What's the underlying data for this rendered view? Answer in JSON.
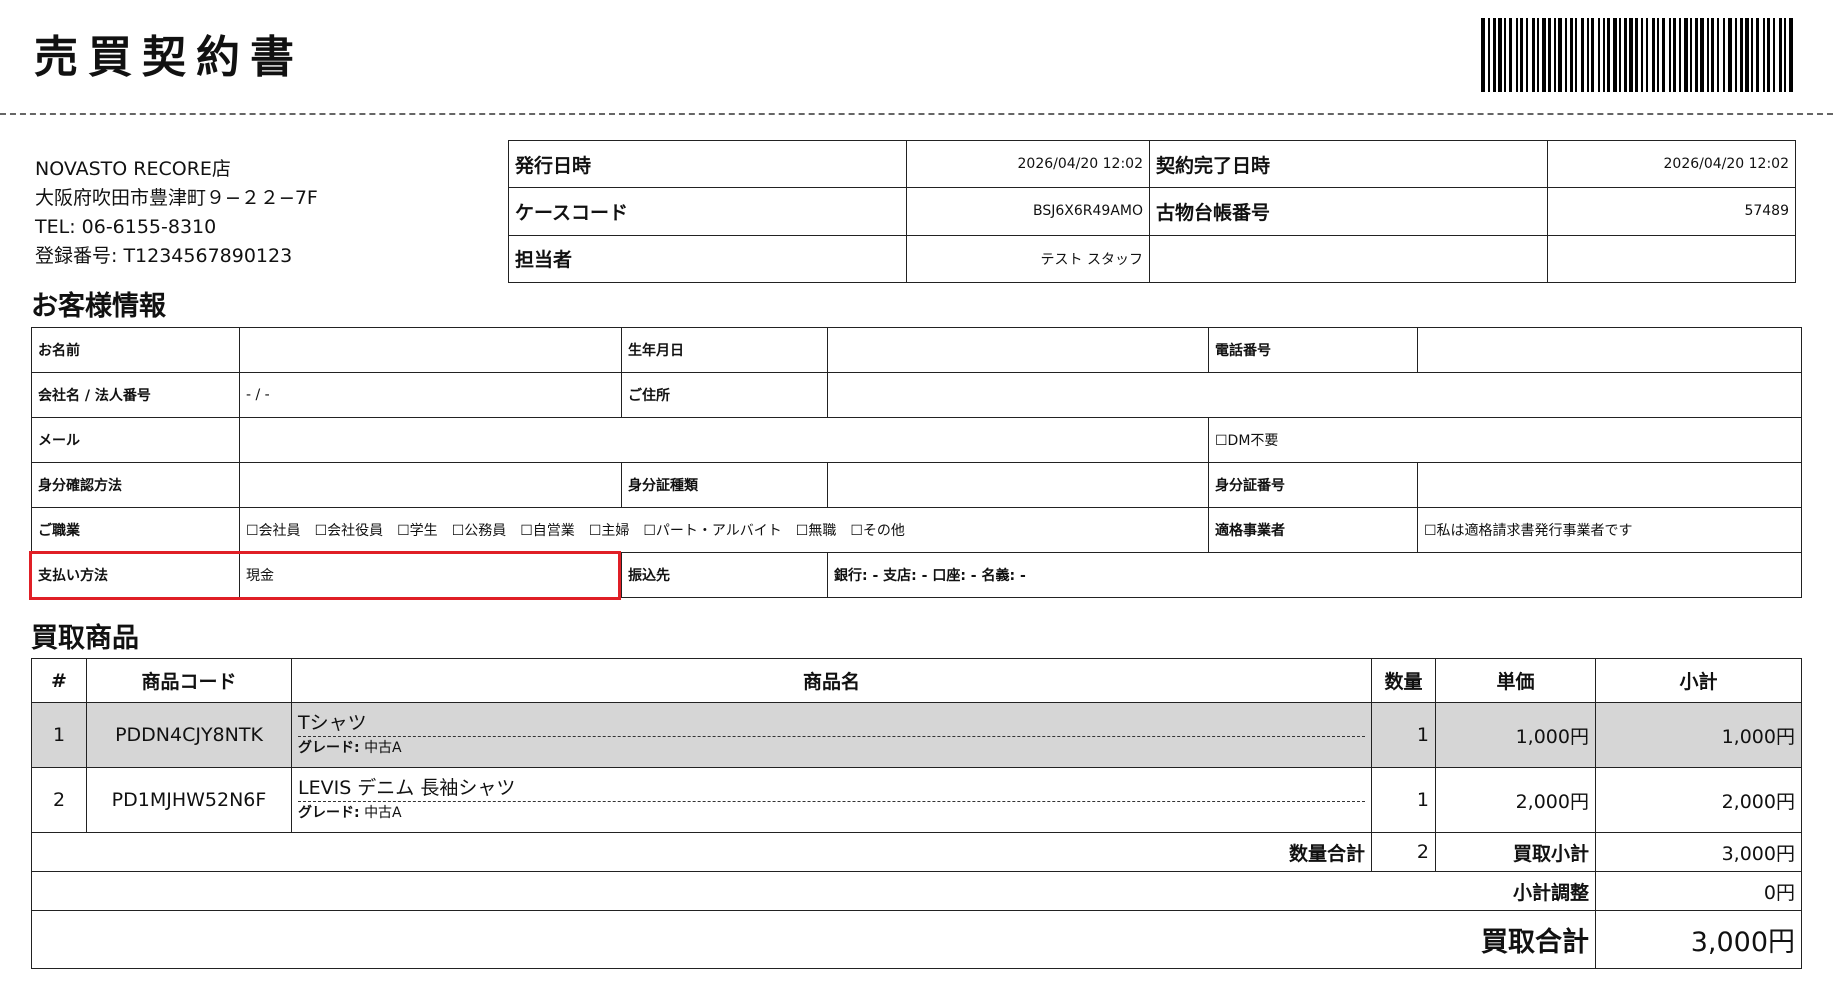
{
  "doc": {
    "title": "売買契約書"
  },
  "shop": {
    "name": "NOVASTO RECORE店",
    "address": "大阪府吹田市豊津町９−２２−7F",
    "tel": "TEL: 06-6155-8310",
    "registration": "登録番号: T1234567890123"
  },
  "meta": {
    "issue_label": "発行日時",
    "issue_value": "2026/04/20 12:02",
    "complete_label": "契約完了日時",
    "complete_value": "2026/04/20 12:02",
    "case_label": "ケースコード",
    "case_value": "BSJ6X6R49AMO",
    "ledger_label": "古物台帳番号",
    "ledger_value": "57489",
    "staff_label": "担当者",
    "staff_value": "テスト スタッフ"
  },
  "customer": {
    "section_title": "お客様情報",
    "name_label": "お名前",
    "birth_label": "生年月日",
    "phone_label": "電話番号",
    "company_label": "会社名 / 法人番号",
    "company_value": "- / -",
    "address_label": "ご住所",
    "email_label": "メール",
    "dm_label": "☐DM不要",
    "id_method_label": "身分確認方法",
    "id_type_label": "身分証種類",
    "id_number_label": "身分証番号",
    "job_label": "ご職業",
    "job_options": [
      "☐会社員",
      "☐会社役員",
      "☐学生",
      "☐公務員",
      "☐自営業",
      "☐主婦",
      "☐パート・アルバイト",
      "☐無職",
      "☐その他"
    ],
    "qualified_label": "適格事業者",
    "qualified_value": "☐私は適格請求書発行事業者です",
    "payment_label": "支払い方法",
    "payment_value": "現金",
    "transfer_label": "振込先",
    "transfer_value": "銀行: - 支店: - 口座: - 名義: -"
  },
  "items": {
    "section_title": "買取商品",
    "headers": {
      "num": "#",
      "code": "商品コード",
      "name": "商品名",
      "qty": "数量",
      "price": "単価",
      "subtotal": "小計"
    },
    "rows": [
      {
        "num": "1",
        "code": "PDDN4CJY8NTK",
        "name": "Tシャツ",
        "grade_label": "グレード:",
        "grade": "中古A",
        "qty": "1",
        "price": "1,000円",
        "subtotal": "1,000円"
      },
      {
        "num": "2",
        "code": "PD1MJHW52N6F",
        "name": "LEVIS デニム 長袖シャツ",
        "grade_label": "グレード:",
        "grade": "中古A",
        "qty": "1",
        "price": "2,000円",
        "subtotal": "2,000円"
      }
    ],
    "qty_total_label": "数量合計",
    "qty_total_value": "2",
    "buy_subtotal_label": "買取小計",
    "buy_subtotal_value": "3,000円",
    "adjust_label": "小計調整",
    "adjust_value": "0円",
    "total_label": "買取合計",
    "total_value": "3,000円"
  },
  "colors": {
    "highlight": "#e01f26",
    "row_shade": "#d6d6d6"
  }
}
